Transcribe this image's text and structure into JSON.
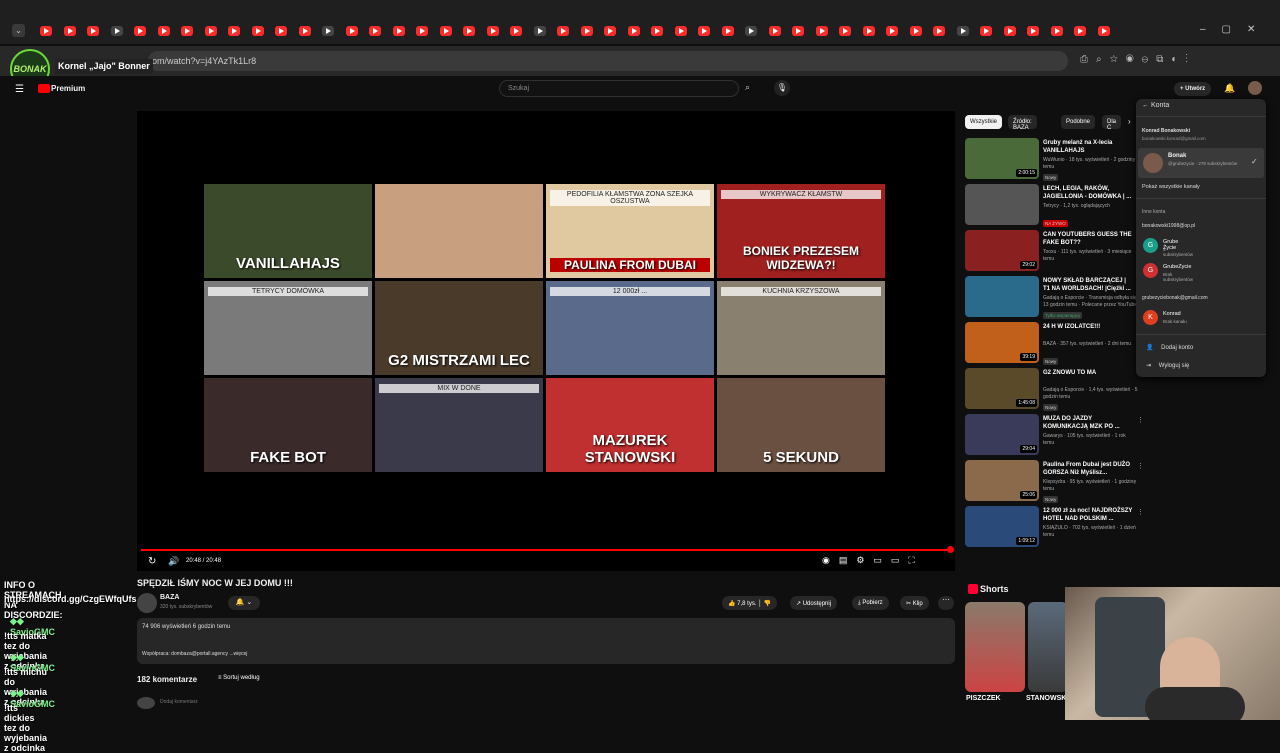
{
  "browser": {
    "url": "om/watch?v=j4YAzTk1Lr8",
    "profile_label": "Kornel „Jajo\" Bonner"
  },
  "youtube": {
    "logo": "Premium",
    "search_placeholder": "Szukaj",
    "create_label": "Utwórz",
    "player": {
      "time": "20:48 / 20:48",
      "thumbs": [
        "VANILLAHAJS",
        "",
        "PAULINA FROM DUBAI",
        "BONIEK PREZESEM WIDZEWA?!",
        "",
        "G2 MISTRZAMI LEC",
        "",
        "",
        "FAKE BOT",
        "",
        "MAZUREK STANOWSKI",
        "5 SEKUND"
      ],
      "thumb_extra": [
        "",
        "",
        "PEDOFILIA  KŁAMSTWA  ZONA SZEJKA  OSZUSTWA",
        "WYKRYWACZ KŁAMSTW",
        "TETRYCY  DOMÓWKA",
        "",
        "12 000zł ...",
        "KUCHNIA KRZYSZOWA",
        "",
        "MIX W DONE",
        "",
        ""
      ]
    },
    "video": {
      "title": "SPĘDZIŁ IŚMY NOC W JEJ DOMU !!!",
      "channel": "BAZA",
      "subs": "320 tys. subskrybentów",
      "likes": "7,8 tys.",
      "share": "Udostępnij",
      "download": "Pobierz",
      "clip": "Klip",
      "views": "74 906 wyświetleń  6 godzin temu",
      "desc": "Współpraca: dombaza@portall.agency  ...więcej",
      "comments": "182 komentarze",
      "sort": "Sortuj według",
      "add_comment": "Dodaj komentarz"
    },
    "chips": [
      "Wszystkie",
      "Źródło: BAZA",
      "Podobne",
      "Dla C"
    ],
    "sidebar": [
      {
        "title": "Gruby melanż na X-lecia VANILLAHAJS",
        "meta": "WuWunio · 18 tys. wyświetleń · 2 godziny temu",
        "badge": "Nowy",
        "dur": "2:00:15",
        "color": "#4a6a3a"
      },
      {
        "title": "LECH, LEGIA, RAKÓW, JAGIELLONIA - DOMÓWKA | ...",
        "meta": "Tetrycy · 1,2 tys. oglądających",
        "badge": "NA ŻYWO",
        "dur": "",
        "color": "#555"
      },
      {
        "title": "CAN YOUTUBERS GUESS THE FAKE BOT??",
        "meta": "Tooxu · 111 tys. wyświetleń · 3 miesiące temu",
        "badge": "",
        "dur": "29:02",
        "color": "#8a2020"
      },
      {
        "title": "NOWY SKŁAD BARCZĄCEJ | T1 NA WORLDSACH! |Cięźki ...",
        "meta": "Gadają o Esporcie · Transmisja odbyła się 13 godzin temu · Polecane przez YouTube",
        "badge": "Tylko wspierający",
        "dur": "",
        "color": "#2a6a8a"
      },
      {
        "title": "24 H W IZOLATCE!!!",
        "meta": "BAZA · 357 tys. wyświetleń · 2 dni temu",
        "badge": "Nowy",
        "dur": "39:19",
        "color": "#c0601a"
      },
      {
        "title": "G2 ZNOWU TO MA",
        "meta": "Gadają o Esporcie · 1,4 tys. wyświetleń · 5 godzin temu",
        "badge": "Nowy",
        "dur": "1:45:08",
        "color": "#5a4a2a"
      },
      {
        "title": "MUZA DO JAZDY KOMUNIKACJĄ MZK PO ...",
        "meta": "Gawarys · 105 tys. wyświetleń · 1 rok temu",
        "badge": "",
        "dur": "29:04",
        "color": "#3a3a5a"
      },
      {
        "title": "Paulina From Dubai jest DUŻO GORSZA Niż Myślisz...",
        "meta": "Klepsydra · 95 tys. wyświetleń · 1 godzinę temu",
        "badge": "Nowy",
        "dur": "25:06",
        "color": "#8a6a4a"
      },
      {
        "title": "12 000 zł za noc! NAJDROŻSZY HOTEL NAD POLSKIM ...",
        "meta": "KSIĄŻULO · 702 tys. wyświetleń · 1 dzień temu",
        "badge": "",
        "dur": "1:09:12",
        "color": "#2a4a7a"
      }
    ],
    "shorts_title": "Shorts",
    "shorts": [
      "PISZCZEK",
      "STANOWSKI"
    ],
    "account_menu": {
      "header": "Konta",
      "name": "Konrad Bonakowski",
      "email": "bonakowski.konrad@gmail.com",
      "accounts": [
        {
          "name": "Bonak",
          "sub": "@grubezycie · 278 subskrybentów",
          "color": "#7a5a4a"
        }
      ],
      "show_all": "Pokaż wszystkie kanały",
      "other_label": "Inne konta",
      "other_email": "bonakowski1998@op.pl",
      "other_accounts": [
        {
          "name": "Grube Życie",
          "sub": "5 subskrybentów",
          "color": "#1aa08a"
        },
        {
          "name": "GrubeZycie",
          "sub": "Brak subskrybentów",
          "color": "#d03030"
        }
      ],
      "third_email": "grubezyciebonak@gmail.com",
      "third_accounts": [
        {
          "name": "Konrad",
          "sub": "Brak kanału",
          "color": "#e04020"
        }
      ],
      "add": "Dodaj konto",
      "logout": "Wyloguj się"
    }
  },
  "stream_chat": [
    {
      "type": "msg",
      "text": "INFO O STREAMACH NA DISCORDZIE:"
    },
    {
      "type": "msg",
      "text": "https://discord.gg/CzgEWfqUfs"
    },
    {
      "type": "name",
      "text": "SavioGMC"
    },
    {
      "type": "msg",
      "text": "!tts matka tez do wyjebania z odcinka"
    },
    {
      "type": "name",
      "text": "SavioGMC"
    },
    {
      "type": "msg",
      "text": "!tts michu do wyjebania z odcinka"
    },
    {
      "type": "name",
      "text": "SavioGMC"
    },
    {
      "type": "msg",
      "text": "!tts dickies tez do wyjebania z odcinka"
    }
  ]
}
